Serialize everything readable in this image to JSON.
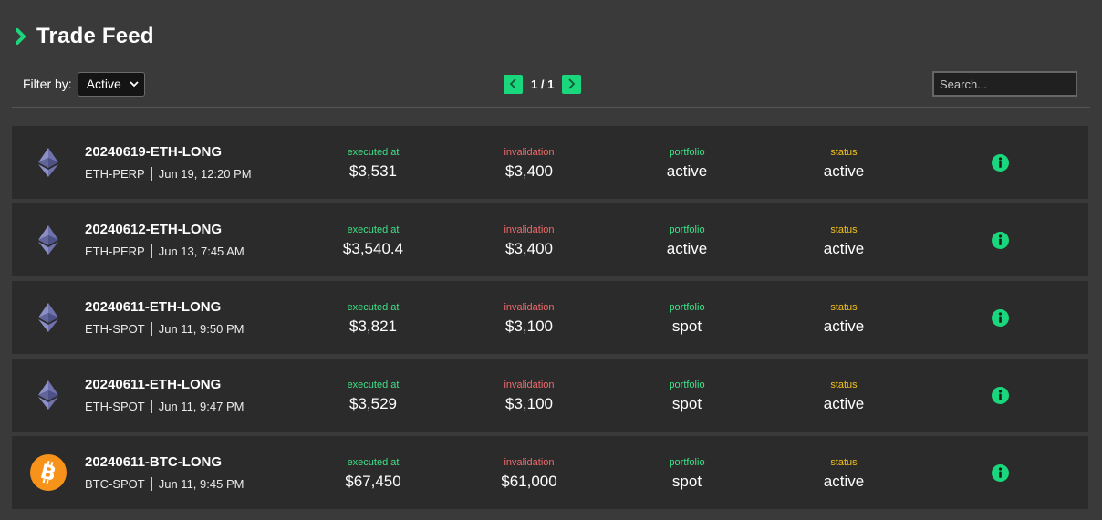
{
  "header": {
    "title": "Trade Feed",
    "icon": "chevron-right-icon",
    "accent": "#1ad67c"
  },
  "filter": {
    "label": "Filter by:",
    "selected": "Active"
  },
  "pagination": {
    "info": "1 / 1"
  },
  "search": {
    "placeholder": "Search..."
  },
  "columns": {
    "executed": "executed at",
    "invalidation": "invalidation",
    "portfolio": "portfolio",
    "status": "status"
  },
  "colors": {
    "executed_label": "#3ee085",
    "invalidation_label": "#f06a6a",
    "portfolio_label": "#3ee085",
    "status_label": "#f2c21a",
    "info_icon": "#1ad67c",
    "btc_icon": "#f7931a"
  },
  "trades": [
    {
      "coin": "eth",
      "id": "20240619-ETH-LONG",
      "instrument": "ETH-PERP",
      "time": "Jun 19, 12:20 PM",
      "executed": "$3,531",
      "invalidation": "$3,400",
      "portfolio": "active",
      "status": "active"
    },
    {
      "coin": "eth",
      "id": "20240612-ETH-LONG",
      "instrument": "ETH-PERP",
      "time": "Jun 13, 7:45 AM",
      "executed": "$3,540.4",
      "invalidation": "$3,400",
      "portfolio": "active",
      "status": "active"
    },
    {
      "coin": "eth",
      "id": "20240611-ETH-LONG",
      "instrument": "ETH-SPOT",
      "time": "Jun 11, 9:50 PM",
      "executed": "$3,821",
      "invalidation": "$3,100",
      "portfolio": "spot",
      "status": "active"
    },
    {
      "coin": "eth",
      "id": "20240611-ETH-LONG",
      "instrument": "ETH-SPOT",
      "time": "Jun 11, 9:47 PM",
      "executed": "$3,529",
      "invalidation": "$3,100",
      "portfolio": "spot",
      "status": "active"
    },
    {
      "coin": "btc",
      "id": "20240611-BTC-LONG",
      "instrument": "BTC-SPOT",
      "time": "Jun 11, 9:45 PM",
      "executed": "$67,450",
      "invalidation": "$61,000",
      "portfolio": "spot",
      "status": "active"
    }
  ]
}
